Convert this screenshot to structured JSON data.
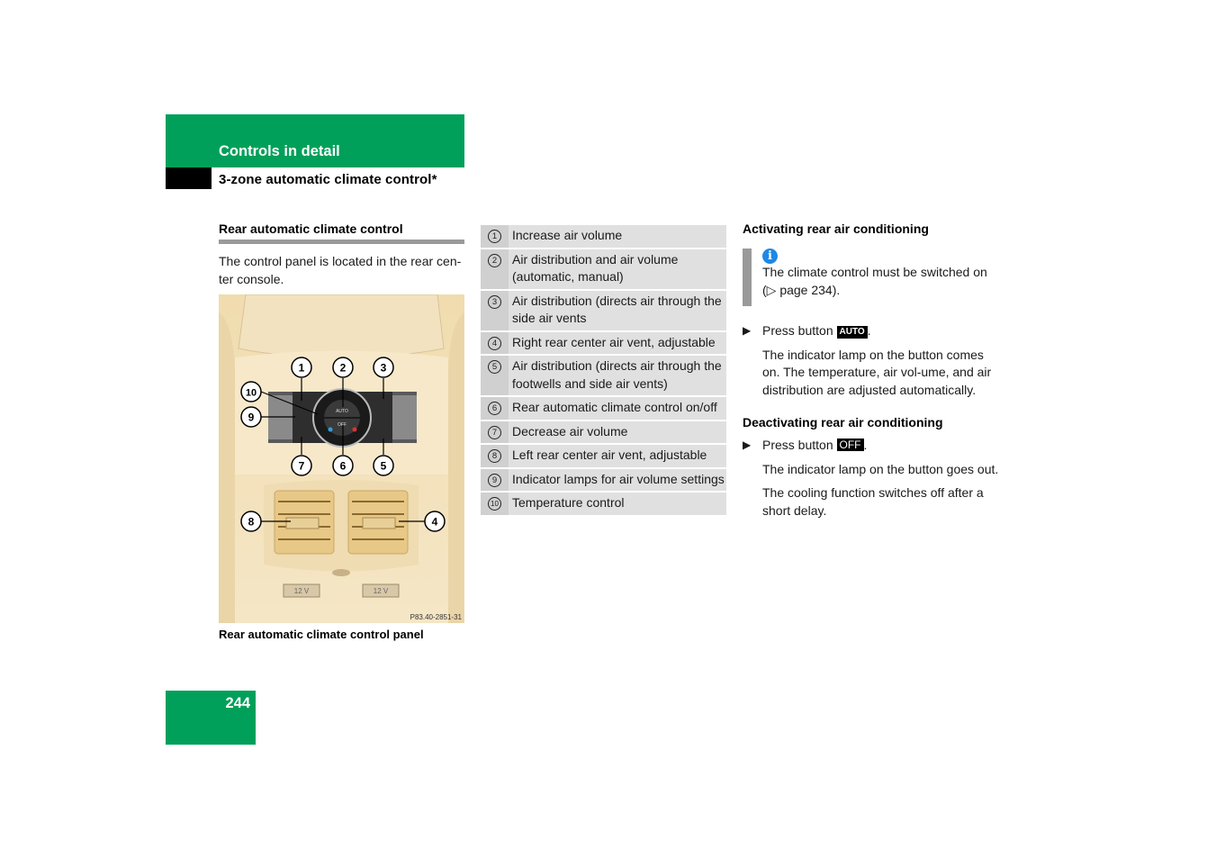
{
  "header": {
    "section": "Controls in detail",
    "subsection": "3-zone automatic climate control*"
  },
  "left": {
    "heading": "Rear automatic climate control",
    "intro": "The control panel is located in the rear cen-ter console.",
    "figure": {
      "image_code": "P83.40-2851-31",
      "caption": "Rear automatic climate control panel",
      "callouts": [
        "1",
        "2",
        "3",
        "4",
        "5",
        "6",
        "7",
        "8",
        "9",
        "10"
      ],
      "panel_labels": {
        "auto": "AUTO",
        "off": "OFF",
        "outlet": "12 V"
      }
    }
  },
  "legend": [
    {
      "num": "1",
      "text": "Increase air volume"
    },
    {
      "num": "2",
      "text": "Air distribution and air volume (automatic, manual)"
    },
    {
      "num": "3",
      "text": "Air distribution (directs air through the side air vents"
    },
    {
      "num": "4",
      "text": "Right rear center air vent, adjustable"
    },
    {
      "num": "5",
      "text": "Air distribution (directs air through the footwells and side air vents)"
    },
    {
      "num": "6",
      "text": "Rear automatic climate control on/off"
    },
    {
      "num": "7",
      "text": "Decrease air volume"
    },
    {
      "num": "8",
      "text": "Left rear center air vent, adjustable"
    },
    {
      "num": "9",
      "text": "Indicator lamps for air volume settings"
    },
    {
      "num": "10",
      "text": "Temperature control"
    }
  ],
  "right": {
    "activating": {
      "heading": "Activating rear air conditioning",
      "info_icon": "i",
      "info_text": "The climate control must be switched on (▷ page 234).",
      "step_prefix": "Press button",
      "step_key": "AUTO",
      "step_suffix": ".",
      "result": "The indicator lamp on the button comes on. The temperature, air vol-ume, and air distribution are adjusted automatically."
    },
    "deactivating": {
      "heading": "Deactivating rear air conditioning",
      "step_prefix": "Press button",
      "step_key": "OFF",
      "step_suffix": ".",
      "result1": "The indicator lamp on the button goes out.",
      "result2": "The cooling function switches off after a short delay."
    },
    "bullet": "▶"
  },
  "footer": {
    "page_number": "244"
  },
  "colors": {
    "brand_green": "#00a05a",
    "info_blue": "#1e88e5",
    "rule_gray": "#9a9a9a"
  }
}
